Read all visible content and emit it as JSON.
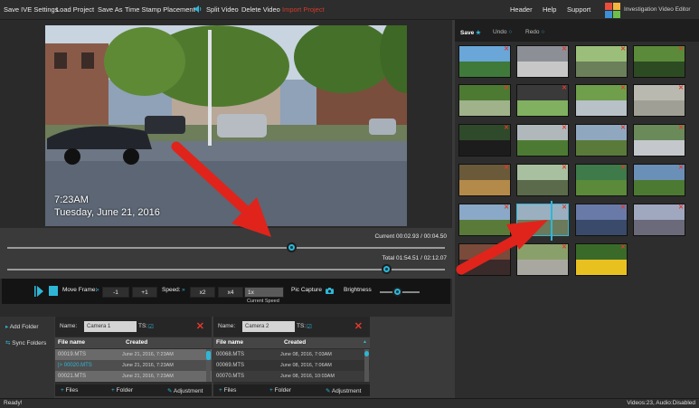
{
  "menu": {
    "items": [
      "Save IVE Settings",
      "Load Project",
      "Save As",
      "Time Stamp Placement",
      "Split Video",
      "Delete Video",
      "Import Project"
    ],
    "right_items": [
      "Header",
      "Help",
      "Support"
    ],
    "logo_text": "Investigation Video Editor"
  },
  "video": {
    "time_overlay": "7:23AM",
    "date_overlay": "Tuesday, June 21, 2016"
  },
  "timeline": {
    "current_label": "Current 00:02.93 / 00:04.50",
    "total_label": "Total 01:54.51 / 02:12.07",
    "current_progress": 0.65,
    "total_progress": 0.867
  },
  "controls": {
    "move_frame_label": "Move Frame:",
    "minus_one": "-1",
    "plus_one": "+1",
    "speed_label": "Speed:",
    "x2": "x2",
    "x4": "x4",
    "current_speed_value": "1x",
    "current_speed_caption": "Current Speed",
    "pic_capture": "Pic Capture",
    "brightness": "Brightness",
    "brightness_level": 0.45
  },
  "folders": {
    "add_folder": "Add Folder",
    "sync_folders": "Sync Folders"
  },
  "panel1": {
    "name_label": "Name:",
    "name_value": "Camera 1",
    "ts_label": "TS:",
    "col_file": "File name",
    "col_created": "Created",
    "rows": [
      {
        "file": "00019.MTS",
        "created": "June 21, 2016, 7:23AM",
        "active": false
      },
      {
        "file": "|> 00020.MTS",
        "created": "June 21, 2016, 7:23AM",
        "active": true
      },
      {
        "file": "00021.MTS",
        "created": "June 21, 2016, 7:23AM",
        "active": false
      }
    ],
    "files_btn": "Files",
    "folder_btn": "Folder",
    "adjustment_btn": "Adjustment"
  },
  "panel2": {
    "name_label": "Name:",
    "name_value": "Camera 2",
    "ts_label": "TS:",
    "col_file": "File name",
    "col_created": "Created",
    "rows": [
      {
        "file": "00068.MTS",
        "created": "June 08, 2016, 7:03AM",
        "active": false
      },
      {
        "file": "00069.MTS",
        "created": "June 08, 2016, 7:06AM",
        "active": false
      },
      {
        "file": "00070.MTS",
        "created": "June 08, 2016, 10:03AM",
        "active": false
      }
    ],
    "files_btn": "Files",
    "folder_btn": "Folder",
    "adjustment_btn": "Adjustment"
  },
  "right": {
    "tabs": [
      {
        "label": "Save",
        "active": true
      },
      {
        "label": "Undo",
        "active": false
      },
      {
        "label": "Redo",
        "active": false
      }
    ]
  },
  "status": {
    "left": "Ready!",
    "right": "Videos:23, Audio:Disabled"
  },
  "colors": {
    "accent": "#2fb6d6",
    "danger": "#e0392b",
    "arrow": "#e0241b"
  }
}
